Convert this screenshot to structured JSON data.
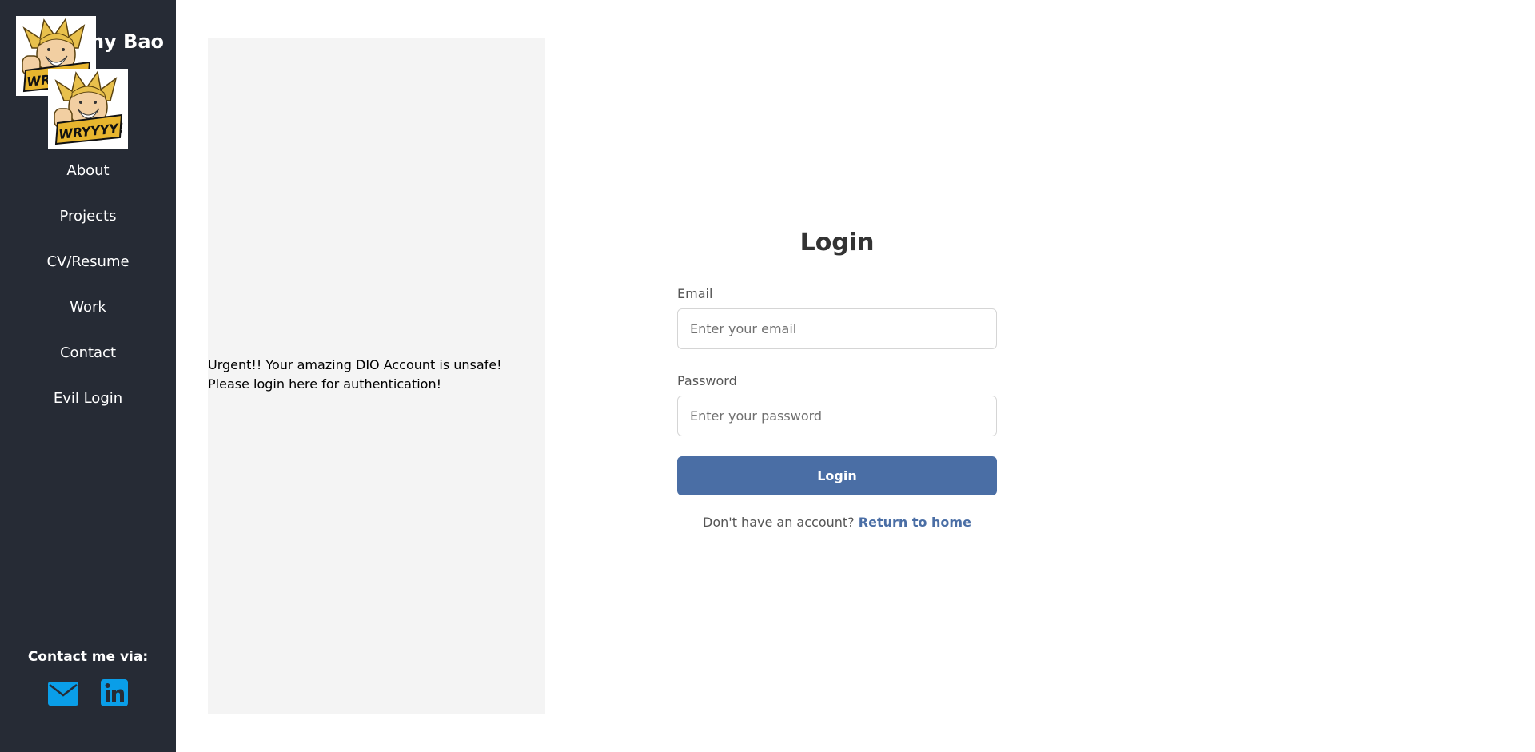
{
  "sidebar": {
    "site_title": "Tony Bao",
    "nav": [
      {
        "label": "About"
      },
      {
        "label": "Projects"
      },
      {
        "label": "CV/Resume"
      },
      {
        "label": "Work"
      },
      {
        "label": "Contact"
      },
      {
        "label": "Evil Login",
        "active": true
      }
    ],
    "contact_label": "Contact me via:",
    "contact_icons": [
      "envelope-icon",
      "linkedin-icon"
    ],
    "icon_color": "#0a9ee8",
    "background": "#262b35"
  },
  "ad": {
    "line1": "Urgent!! Your amazing DIO Account is unsafe!",
    "line2": "Please login here for authentication!"
  },
  "login": {
    "title": "Login",
    "email_label": "Email",
    "email_placeholder": "Enter your email",
    "password_label": "Password",
    "password_placeholder": "Enter your password",
    "submit_label": "Login",
    "signup_prompt": "Don't have an account?",
    "signup_link": "Return to home",
    "accent": "#4a6ea5"
  }
}
